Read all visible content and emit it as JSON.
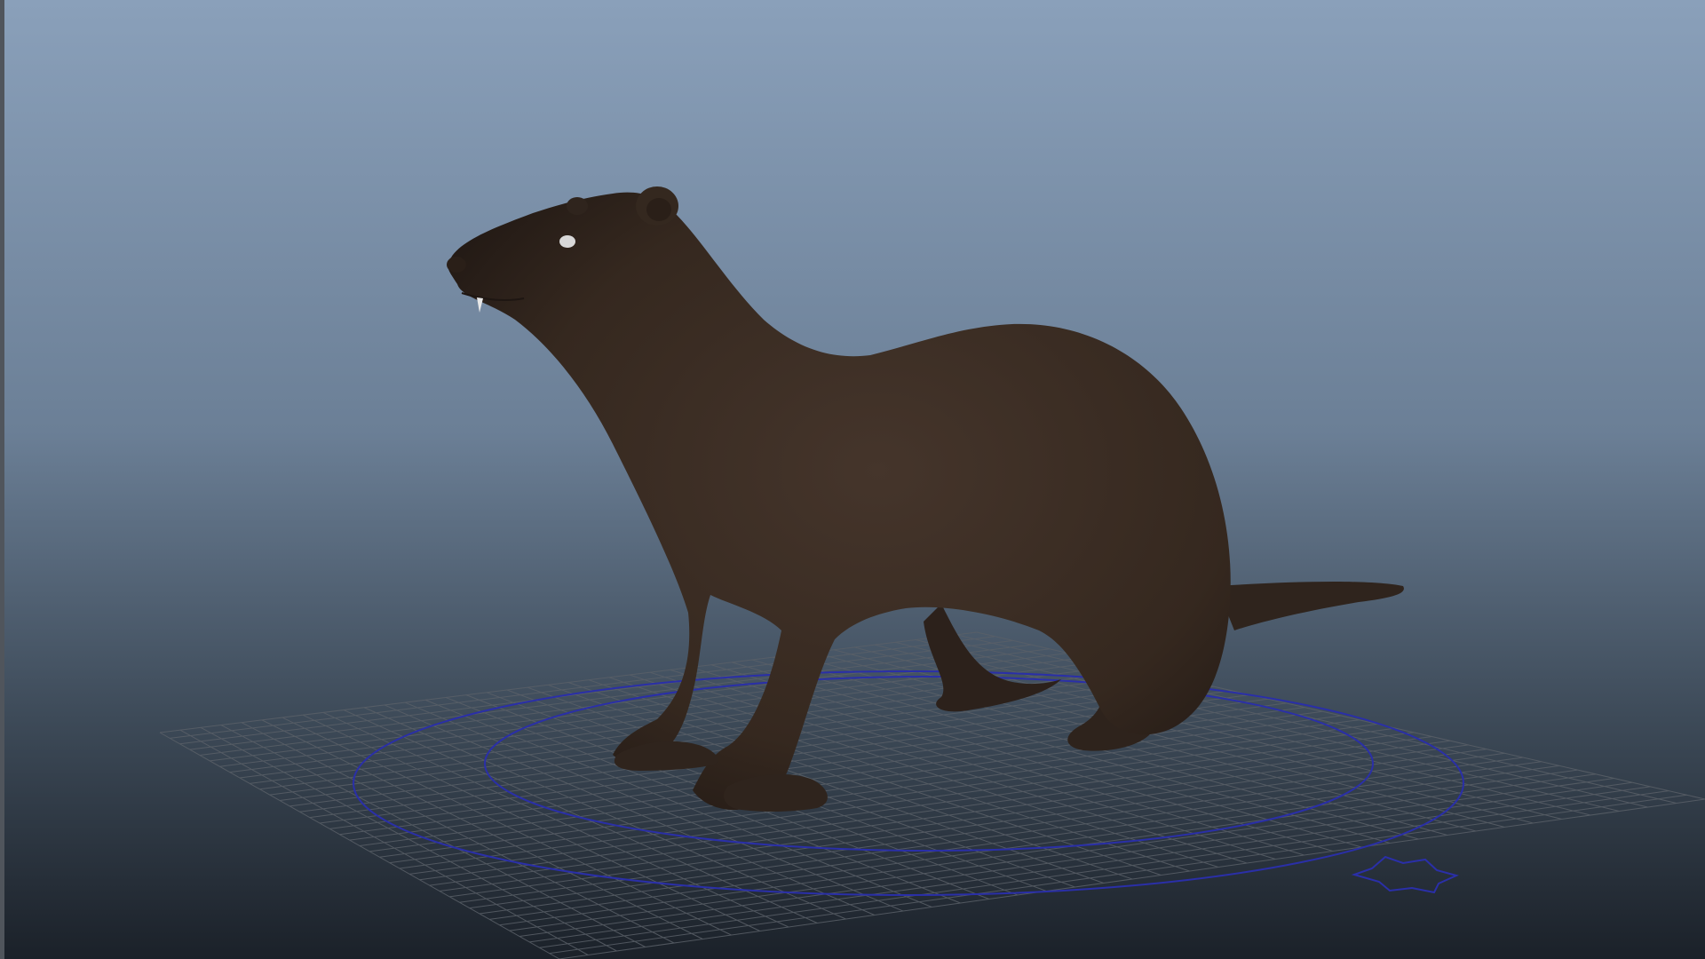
{
  "viewport": {
    "name": "maya-perspective-viewport",
    "background_top": "#8aa0ba",
    "background_bottom": "#1b2129",
    "grid_color": "#5a6068",
    "manipulator_color": "#2a2fa8"
  },
  "model": {
    "subject": "ferret",
    "body_color": "#3a2c24",
    "eye_color": "#d8d8d8"
  }
}
